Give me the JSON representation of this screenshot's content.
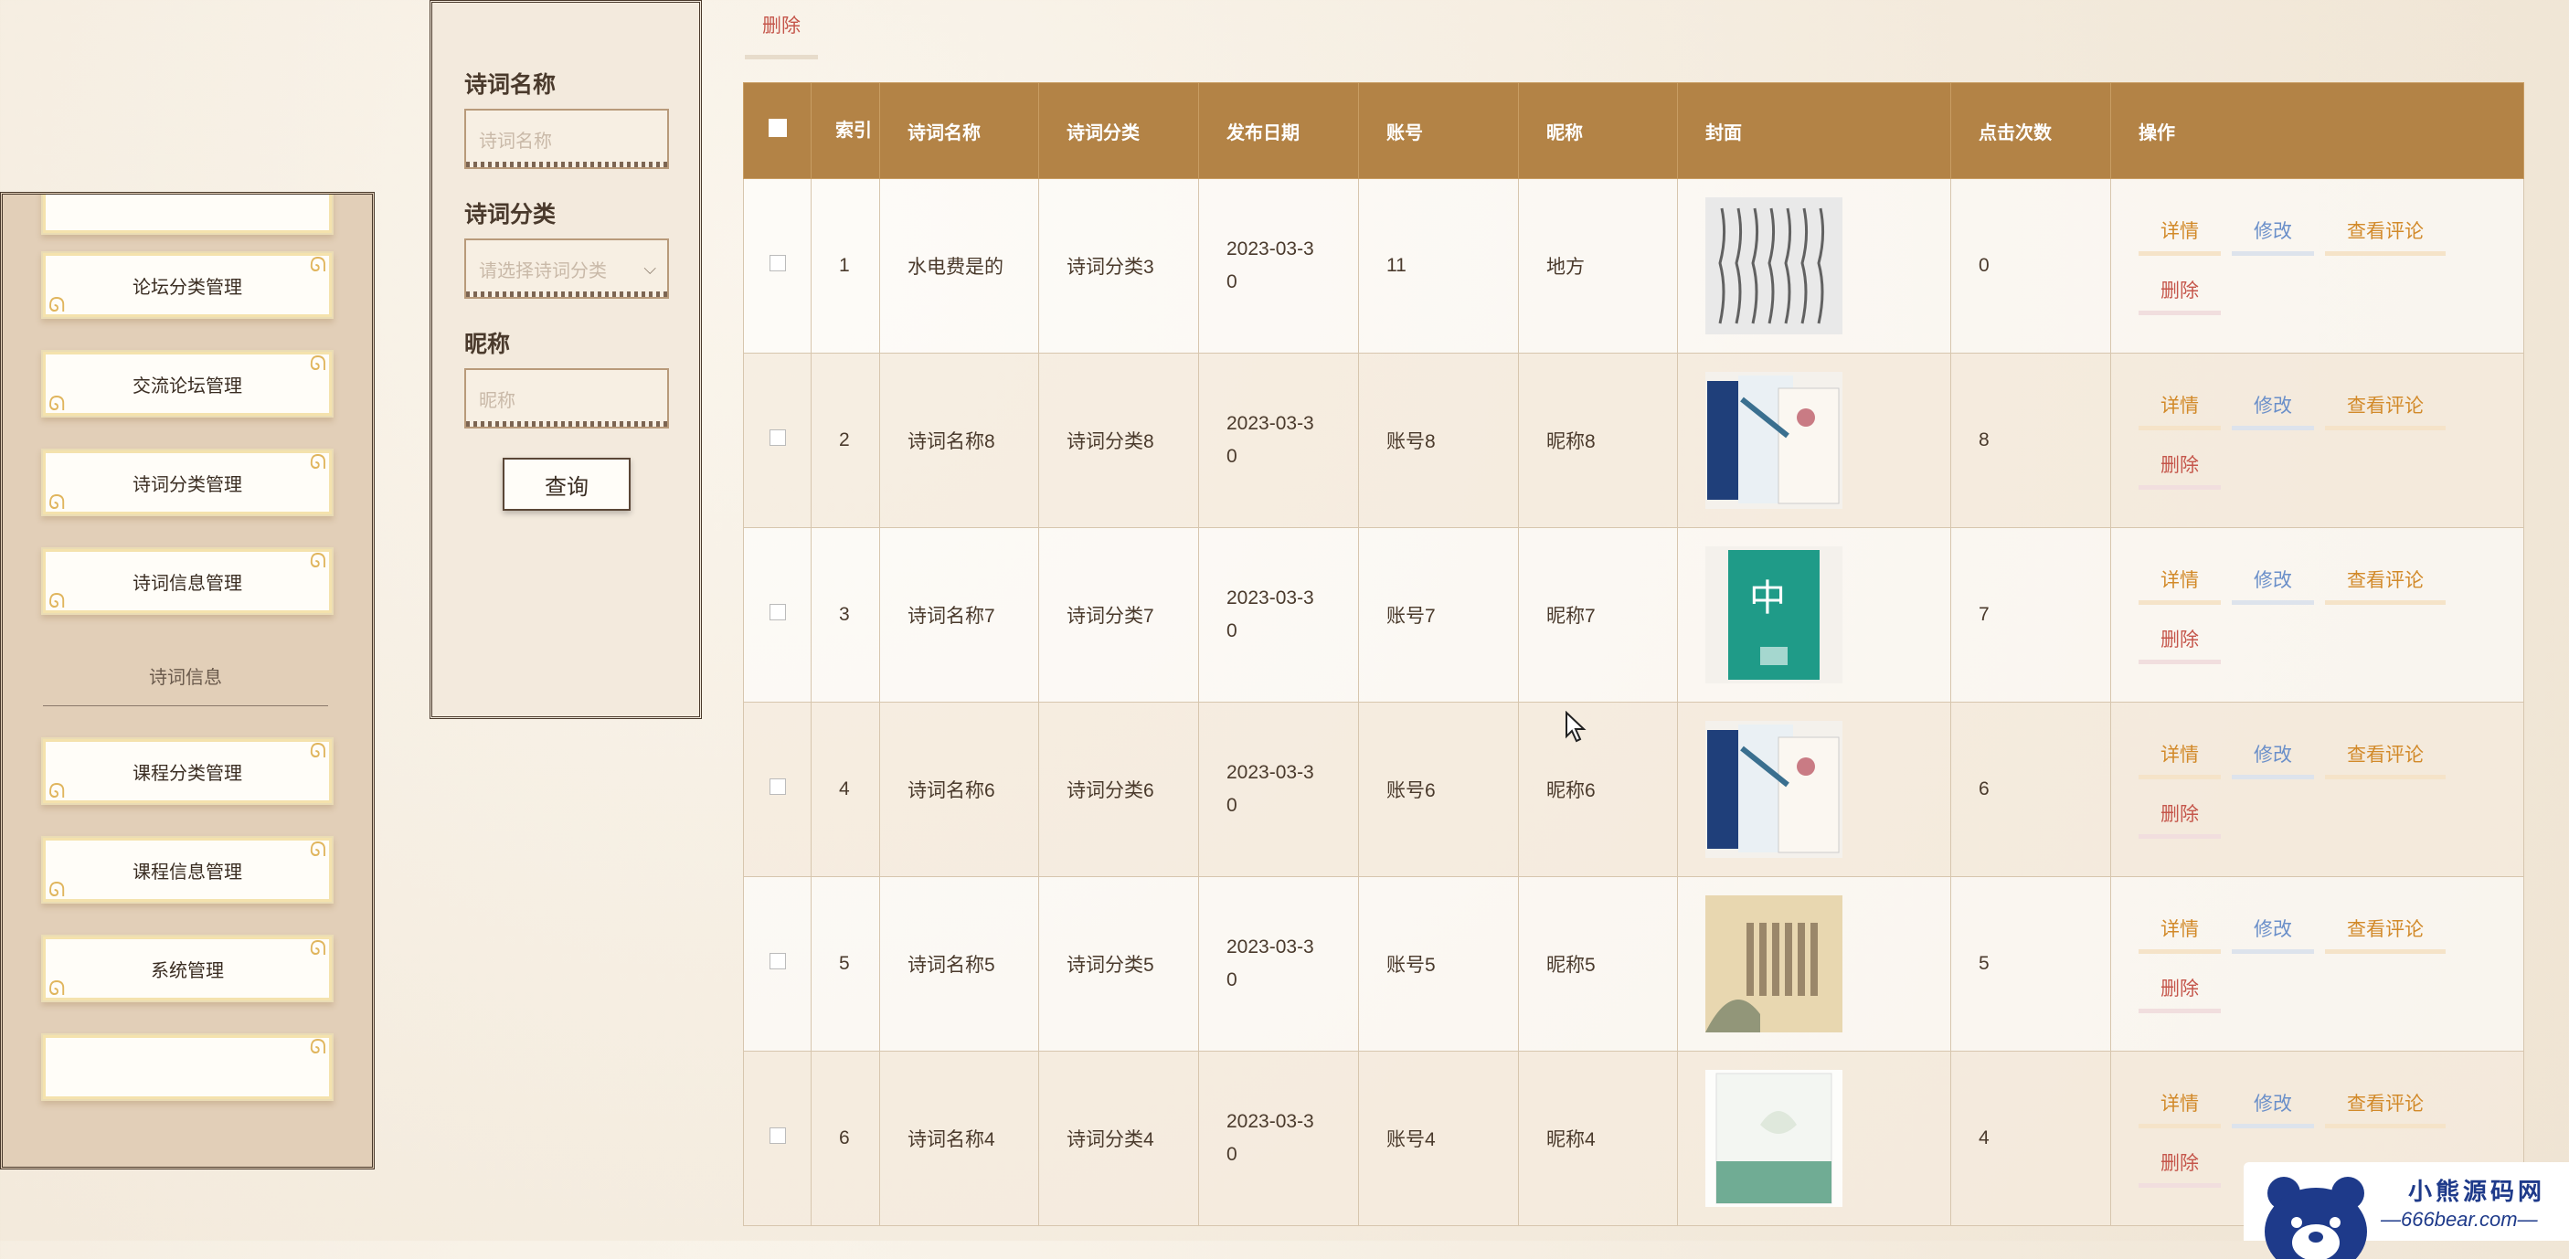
{
  "sidebar": {
    "items": [
      {
        "label": ""
      },
      {
        "label": "论坛分类管理"
      },
      {
        "label": "交流论坛管理"
      },
      {
        "label": "诗词分类管理"
      },
      {
        "label": "诗词信息管理"
      },
      {
        "label": "课程分类管理"
      },
      {
        "label": "课程信息管理"
      },
      {
        "label": "系统管理"
      },
      {
        "label": ""
      }
    ],
    "group_label": "诗词信息"
  },
  "search": {
    "name_label": "诗词名称",
    "name_placeholder": "诗词名称",
    "category_label": "诗词分类",
    "category_placeholder": "请选择诗词分类",
    "nickname_label": "昵称",
    "nickname_placeholder": "昵称",
    "query_button": "查询"
  },
  "toolbar": {
    "delete_label": "删除"
  },
  "table": {
    "headers": {
      "index": "索引",
      "name": "诗词名称",
      "category": "诗词分类",
      "date": "发布日期",
      "account": "账号",
      "nickname": "昵称",
      "cover": "封面",
      "clicks": "点击次数",
      "actions": "操作"
    },
    "rows": [
      {
        "index": "1",
        "name": "水电费是的",
        "category": "诗词分类3",
        "date_a": "2023-03-3",
        "date_b": "0",
        "account": "11",
        "nickname": "地方",
        "clicks": "0"
      },
      {
        "index": "2",
        "name": "诗词名称8",
        "category": "诗词分类8",
        "date_a": "2023-03-3",
        "date_b": "0",
        "account": "账号8",
        "nickname": "昵称8",
        "clicks": "8"
      },
      {
        "index": "3",
        "name": "诗词名称7",
        "category": "诗词分类7",
        "date_a": "2023-03-3",
        "date_b": "0",
        "account": "账号7",
        "nickname": "昵称7",
        "clicks": "7"
      },
      {
        "index": "4",
        "name": "诗词名称6",
        "category": "诗词分类6",
        "date_a": "2023-03-3",
        "date_b": "0",
        "account": "账号6",
        "nickname": "昵称6",
        "clicks": "6"
      },
      {
        "index": "5",
        "name": "诗词名称5",
        "category": "诗词分类5",
        "date_a": "2023-03-3",
        "date_b": "0",
        "account": "账号5",
        "nickname": "昵称5",
        "clicks": "5"
      },
      {
        "index": "6",
        "name": "诗词名称4",
        "category": "诗词分类4",
        "date_a": "2023-03-3",
        "date_b": "0",
        "account": "账号4",
        "nickname": "昵称4",
        "clicks": "4"
      }
    ],
    "actions": {
      "detail": "详情",
      "edit": "修改",
      "review": "查看评论",
      "delete": "删除"
    }
  },
  "watermark": {
    "title": "小熊源码网",
    "url": "—666bear.com—"
  },
  "colors": {
    "header_bg": "#b38346",
    "accent_orange": "#d28a2a",
    "accent_blue": "#6a8fc9",
    "danger": "#c5564b"
  }
}
